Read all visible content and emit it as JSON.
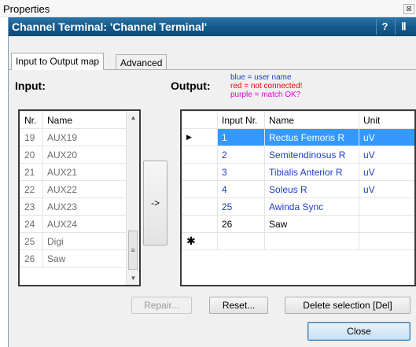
{
  "window": {
    "title": "Properties",
    "close_glyph": "⊠"
  },
  "header": {
    "title": "Channel Terminal: 'Channel Terminal'",
    "help_label": "?",
    "pin_glyph": "Ⅱ"
  },
  "tabs": [
    {
      "label": "Input to Output map",
      "active": true
    },
    {
      "label": "Advanced",
      "active": false
    }
  ],
  "input": {
    "label": "Input:",
    "columns": [
      "Nr.",
      "Name"
    ],
    "rows": [
      {
        "nr": "19",
        "name": "AUX19"
      },
      {
        "nr": "20",
        "name": "AUX20"
      },
      {
        "nr": "21",
        "name": "AUX21"
      },
      {
        "nr": "22",
        "name": "AUX22"
      },
      {
        "nr": "23",
        "name": "AUX23"
      },
      {
        "nr": "24",
        "name": "AUX24"
      },
      {
        "nr": "25",
        "name": "Digi"
      },
      {
        "nr": "26",
        "name": "Saw"
      }
    ]
  },
  "map_button": {
    "label": "->"
  },
  "output": {
    "label": "Output:",
    "legend": {
      "blue": "blue = user name",
      "red": "red = not connected!",
      "purple": "purple = match OK?"
    },
    "columns": [
      "",
      "Input Nr.",
      "Name",
      "Unit"
    ],
    "rows": [
      {
        "marker": "▶",
        "input_nr": "1",
        "name": "Rectus Femoris R",
        "unit": "uV"
      },
      {
        "marker": "",
        "input_nr": "2",
        "name": "Semitendinosus R",
        "unit": "uV"
      },
      {
        "marker": "",
        "input_nr": "3",
        "name": "Tibialis Anterior R",
        "unit": "uV"
      },
      {
        "marker": "",
        "input_nr": "4",
        "name": "Soleus R",
        "unit": "uV"
      },
      {
        "marker": "",
        "input_nr": "25",
        "name": "Awinda Sync",
        "unit": ""
      },
      {
        "marker": "",
        "input_nr": "26",
        "name": "Saw",
        "unit": ""
      }
    ],
    "new_row_marker": "✱"
  },
  "buttons": {
    "repair": "Repair...",
    "reset": "Reset...",
    "delete_selection": "Delete selection [Del]",
    "close": "Close"
  },
  "colors": {
    "header": "#155a8c",
    "user_name_blue": "#1f3dc4",
    "selection": "#3399ff",
    "not_connected_red": "#ff0000",
    "match_purple": "#e000e0"
  }
}
